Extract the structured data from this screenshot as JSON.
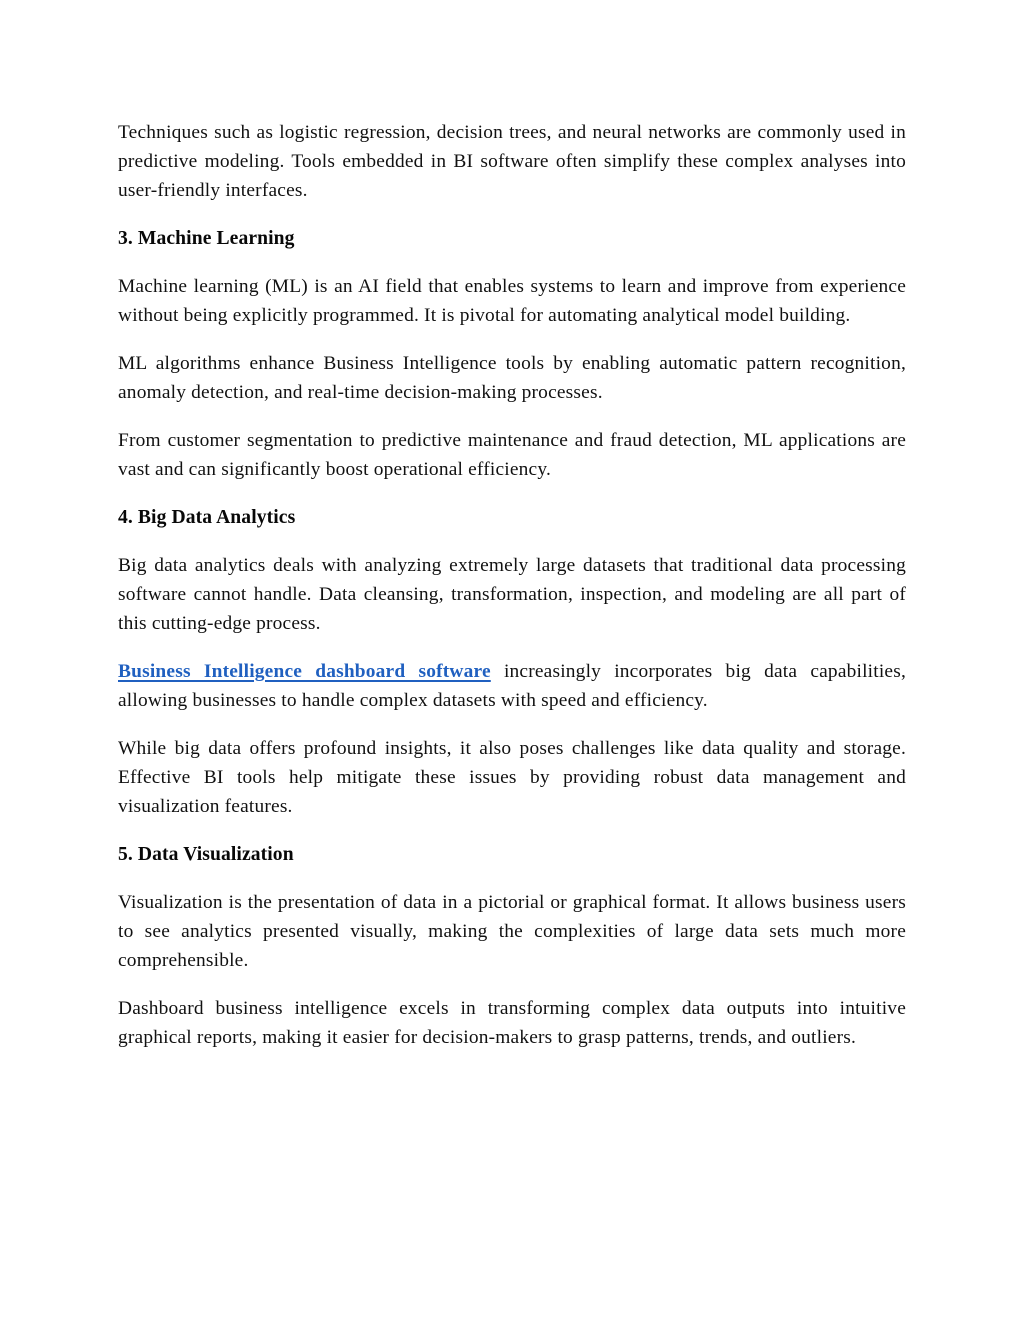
{
  "document": {
    "blocks": [
      {
        "kind": "paragraph",
        "name": "paragraph-techniques",
        "text": "Techniques such as logistic regression, decision trees, and neural networks are commonly used in predictive modeling. Tools embedded in BI software often simplify these complex analyses into user-friendly interfaces."
      },
      {
        "kind": "heading",
        "name": "heading-machine-learning",
        "text": "3. Machine Learning"
      },
      {
        "kind": "paragraph",
        "name": "paragraph-ml-definition",
        "text": "Machine learning (ML) is an AI field that enables systems to learn and improve from experience without being explicitly programmed. It is pivotal for automating analytical model building."
      },
      {
        "kind": "paragraph",
        "name": "paragraph-ml-algorithms",
        "text": "ML algorithms enhance Business Intelligence tools by enabling automatic pattern recognition, anomaly detection, and real-time decision-making processes."
      },
      {
        "kind": "paragraph",
        "name": "paragraph-ml-applications",
        "text": "From customer segmentation to predictive maintenance and fraud detection, ML applications are vast and can significantly boost operational efficiency."
      },
      {
        "kind": "heading",
        "name": "heading-big-data-analytics",
        "text": "4. Big Data Analytics"
      },
      {
        "kind": "paragraph",
        "name": "paragraph-big-data-definition",
        "text": "Big data analytics deals with analyzing extremely large datasets that traditional data processing software cannot handle. Data cleansing, transformation, inspection, and modeling are all part of this cutting-edge process."
      },
      {
        "kind": "paragraph-with-link",
        "name": "paragraph-bi-dashboard-link",
        "link_text": "Business Intelligence dashboard software",
        "text_after_link": " increasingly incorporates big data capabilities, allowing businesses to handle complex datasets with speed and efficiency."
      },
      {
        "kind": "paragraph",
        "name": "paragraph-big-data-challenges",
        "text": "While big data offers profound insights, it also poses challenges like data quality and storage. Effective BI tools help mitigate these issues by providing robust data management and visualization features."
      },
      {
        "kind": "heading",
        "name": "heading-data-visualization",
        "text": "5. Data Visualization"
      },
      {
        "kind": "paragraph",
        "name": "paragraph-visualization-definition",
        "text": "Visualization is the presentation of data in a pictorial or graphical format. It allows business users to see analytics presented visually, making the complexities of large data sets much more comprehensible."
      },
      {
        "kind": "paragraph",
        "name": "paragraph-dashboard-bi",
        "text": "Dashboard business intelligence excels in transforming complex data outputs into intuitive graphical reports, making it easier for decision-makers to grasp patterns, trends, and outliers."
      }
    ]
  },
  "colors": {
    "page_background": "#ffffff",
    "body_text": "#111111",
    "heading_text": "#080808",
    "link": "#2060c0"
  }
}
